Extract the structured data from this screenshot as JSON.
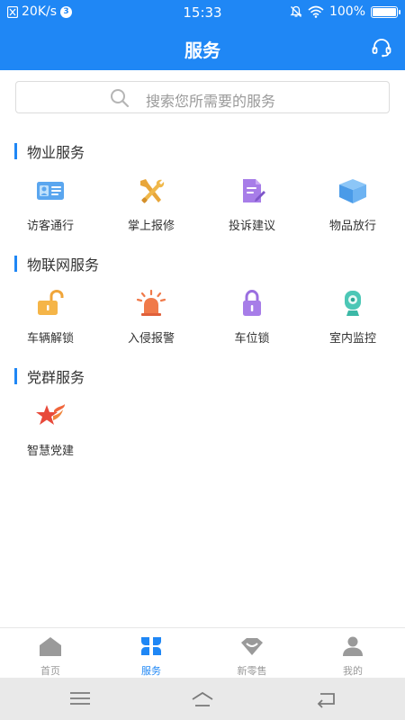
{
  "status_bar": {
    "speed": "20K/s",
    "notif_count": "3",
    "time": "15:33",
    "battery": "100%",
    "battery_level": 1.0
  },
  "header": {
    "title": "服务",
    "action_icon": "headset-icon"
  },
  "search": {
    "placeholder": "搜索您所需要的服务",
    "icon": "search-icon"
  },
  "sections": [
    {
      "title": "物业服务",
      "items": [
        {
          "label": "访客通行",
          "icon": "visitor-card-icon"
        },
        {
          "label": "掌上报修",
          "icon": "repair-tools-icon"
        },
        {
          "label": "投诉建议",
          "icon": "complaint-doc-icon"
        },
        {
          "label": "物品放行",
          "icon": "package-box-icon"
        }
      ]
    },
    {
      "title": "物联网服务",
      "items": [
        {
          "label": "车辆解锁",
          "icon": "unlock-icon"
        },
        {
          "label": "入侵报警",
          "icon": "alarm-light-icon"
        },
        {
          "label": "车位锁",
          "icon": "lock-icon"
        },
        {
          "label": "室内监控",
          "icon": "camera-icon"
        }
      ]
    },
    {
      "title": "党群服务",
      "items": [
        {
          "label": "智慧党建",
          "icon": "party-star-icon"
        }
      ]
    }
  ],
  "bottom_nav": [
    {
      "label": "首页",
      "icon": "home-icon",
      "active": false
    },
    {
      "label": "服务",
      "icon": "services-grid-icon",
      "active": true
    },
    {
      "label": "新零售",
      "icon": "retail-icon",
      "active": false
    },
    {
      "label": "我的",
      "icon": "profile-icon",
      "active": false
    }
  ],
  "colors": {
    "primary": "#1f87f5",
    "nav_inactive": "#9a9a9a",
    "text": "#333333"
  }
}
